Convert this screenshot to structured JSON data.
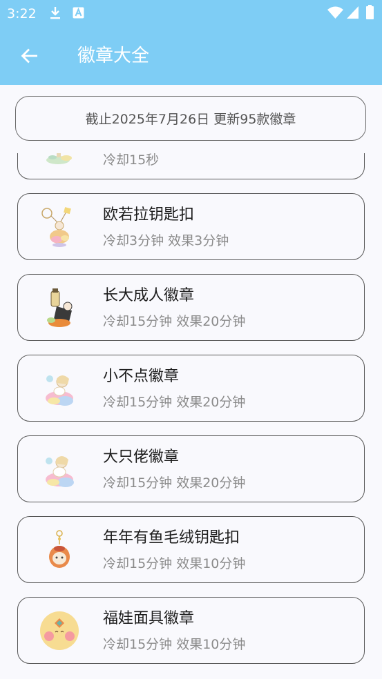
{
  "status_bar": {
    "time": "3:22",
    "icons": [
      "download-icon",
      "a-letter-icon",
      "wifi-icon",
      "signal-icon",
      "battery-icon"
    ]
  },
  "app_bar": {
    "title": "徽章大全",
    "back_icon": "arrow-back-icon"
  },
  "notice": {
    "text": "截止2025年7月26日 更新95款徽章"
  },
  "badges": [
    {
      "detail": "冷却15秒",
      "icon": "badge-image-icon"
    },
    {
      "title": "欧若拉钥匙扣",
      "detail": "冷却3分钟 效果3分钟",
      "icon": "aurora-keychain-icon"
    },
    {
      "title": "长大成人徽章",
      "detail": "冷却15分钟 效果20分钟",
      "icon": "grown-up-badge-icon"
    },
    {
      "title": "小不点徽章",
      "detail": "冷却15分钟 效果20分钟",
      "icon": "little-one-badge-icon"
    },
    {
      "title": "大只佬徽章",
      "detail": "冷却15分钟 效果20分钟",
      "icon": "big-guy-badge-icon"
    },
    {
      "title": "年年有鱼毛绒钥匙扣",
      "detail": "冷却15分钟 效果10分钟",
      "icon": "fish-plush-keychain-icon"
    },
    {
      "title": "福娃面具徽章",
      "detail": "冷却15分钟 效果10分钟",
      "icon": "fuwa-mask-badge-icon"
    }
  ],
  "colors": {
    "accent": "#7ECDF5",
    "background": "#F9F9FD",
    "card_border": "#555555",
    "title_text": "#1C1C1C",
    "detail_text": "#8A8A8A"
  }
}
